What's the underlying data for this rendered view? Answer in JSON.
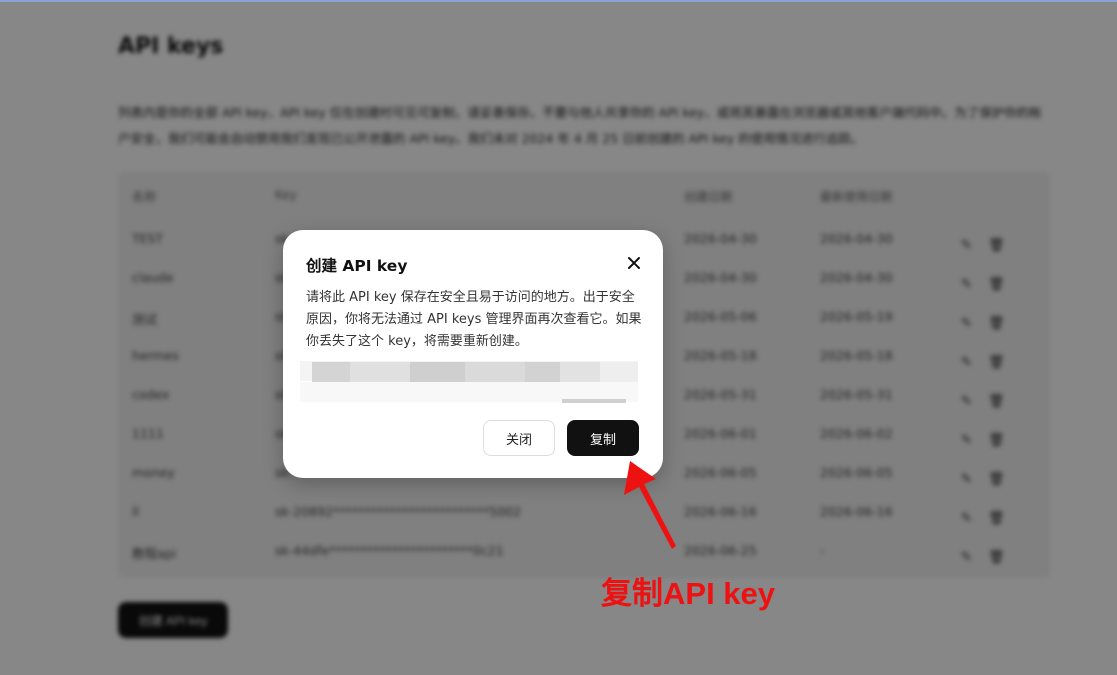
{
  "page": {
    "title": "API keys",
    "description": "列表内是你的全部 API key，API key 仅在创建时可见可复制，请妥善保存。不要与他人共享你的 API key，或将其暴露在浏览器或其他客户端代码中。为了保护你的帐户安全，我们可能会自动禁用我们发现已公开泄露的 API key。我们未对 2024 年 4 月 25 日前创建的 API key 的使用情况进行追踪。",
    "create_button": "创建 API key"
  },
  "table": {
    "headers": [
      "名称",
      "Key",
      "创建日期",
      "最新使用日期"
    ],
    "rows": [
      {
        "name": "TEST",
        "key": "sk-",
        "created": "2026-04-30",
        "last_used": "2026-04-30"
      },
      {
        "name": "claude",
        "key": "sk-",
        "created": "2026-04-30",
        "last_used": "2026-04-30"
      },
      {
        "name": "测试",
        "key": "sk-",
        "created": "2026-05-06",
        "last_used": "2026-05-19"
      },
      {
        "name": "hermes",
        "key": "sk-",
        "created": "2026-05-18",
        "last_used": "2026-05-18"
      },
      {
        "name": "codex",
        "key": "sk-",
        "created": "2026-05-31",
        "last_used": "2026-05-31"
      },
      {
        "name": "1111",
        "key": "sk-",
        "created": "2026-06-01",
        "last_used": "2026-06-02"
      },
      {
        "name": "money",
        "key": "sk-",
        "created": "2026-06-05",
        "last_used": "2026-06-05"
      },
      {
        "name": "ll",
        "key": "sk-20892*************************5002",
        "created": "2026-06-16",
        "last_used": "2026-06-16"
      },
      {
        "name": "教程api",
        "key": "sk-44dfe***********************0c21",
        "created": "2026-06-25",
        "last_used": "-"
      }
    ]
  },
  "modal": {
    "title": "创建 API key",
    "description": "请将此 API key 保存在安全且易于访问的地方。出于安全原因，你将无法通过 API keys 管理界面再次查看它。如果你丢失了这个 key，将需要重新创建。",
    "cancel_label": "关闭",
    "copy_label": "复制"
  },
  "annotation": {
    "text": "复制API key",
    "color": "#ee1111"
  }
}
